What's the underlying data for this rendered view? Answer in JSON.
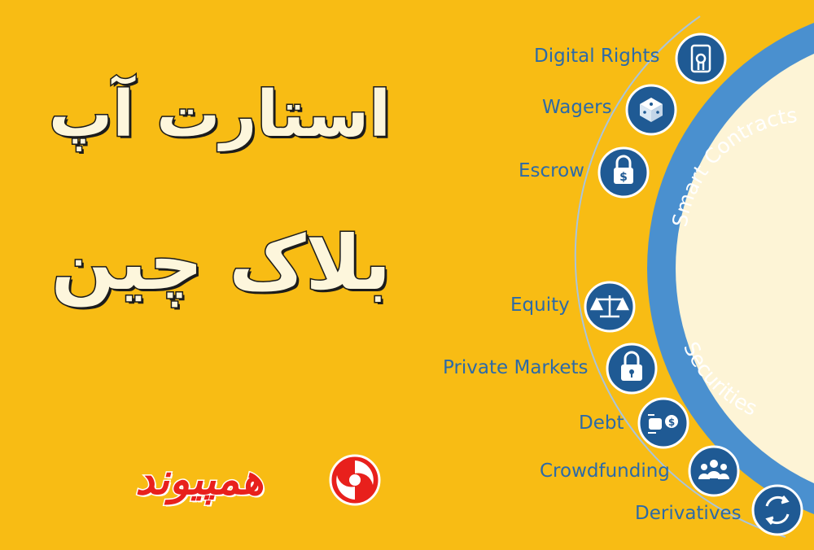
{
  "title": {
    "line1": "استارت آپ",
    "line2": "بلاک چین"
  },
  "logo": {
    "text": "همپیوند"
  },
  "colors": {
    "background": "#f8bc14",
    "ring": "#4a90cf",
    "icon_circle": "#1f5a94",
    "label": "#2c6aa8",
    "inner_circle": "#fdf4d6",
    "logo_red": "#e8201c"
  },
  "diagram": {
    "ring_labels": {
      "smart_contracts": "Smart Contracts",
      "securities": "Securities"
    },
    "groups": [
      {
        "name": "Smart Contracts",
        "items": [
          {
            "label": "Digital Rights",
            "icon": "touch-screen-icon"
          },
          {
            "label": "Wagers",
            "icon": "dice-icon"
          },
          {
            "label": "Escrow",
            "icon": "padlock-dollar-icon"
          }
        ]
      },
      {
        "name": "Securities",
        "items": [
          {
            "label": "Equity",
            "icon": "balance-scale-icon"
          },
          {
            "label": "Private Markets",
            "icon": "padlock-icon"
          },
          {
            "label": "Debt",
            "icon": "hand-money-icon"
          },
          {
            "label": "Crowdfunding",
            "icon": "people-group-icon"
          },
          {
            "label": "Derivatives",
            "icon": "exchange-arrows-icon"
          }
        ]
      }
    ]
  }
}
